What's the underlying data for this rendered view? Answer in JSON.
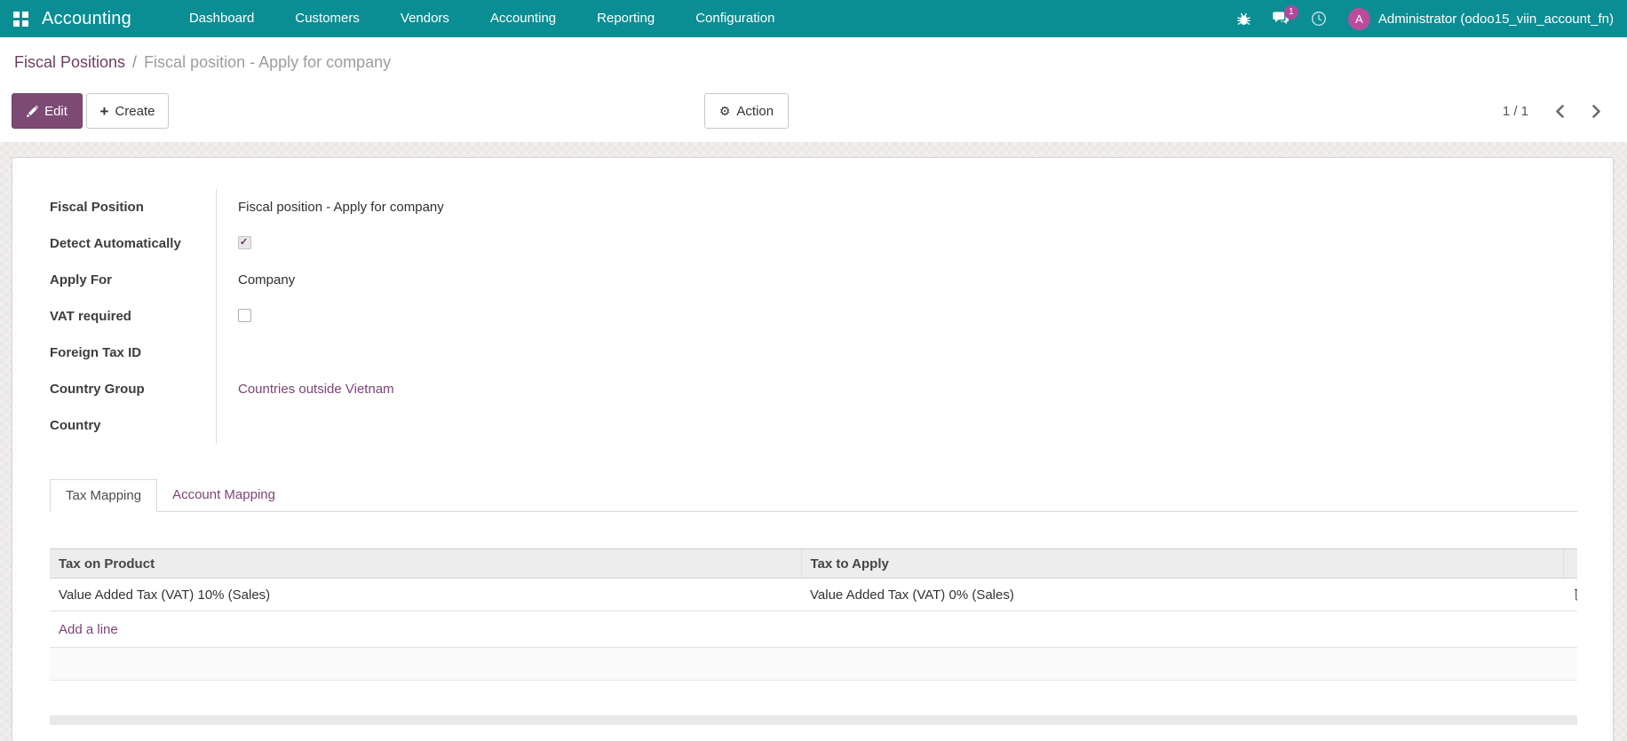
{
  "navbar": {
    "brand": "Accounting",
    "menu_items": [
      "Dashboard",
      "Customers",
      "Vendors",
      "Accounting",
      "Reporting",
      "Configuration"
    ],
    "badge_count": "1",
    "avatar_letter": "A",
    "user_name": "Administrator (odoo15_viin_account_fn)",
    "icons": [
      "apps-grid-icon",
      "bug-icon",
      "messages-icon",
      "activity-clock-icon"
    ]
  },
  "breadcrumb": {
    "parent": "Fiscal Positions",
    "separator": "/",
    "current": "Fiscal position - Apply for company"
  },
  "actions": {
    "edit": "Edit",
    "create": "Create",
    "action": "Action"
  },
  "pager": {
    "value": "1 / 1"
  },
  "form": {
    "fields": [
      {
        "label": "Fiscal Position",
        "type": "text",
        "value": "Fiscal position - Apply for company"
      },
      {
        "label": "Detect Automatically",
        "type": "checkbox",
        "checked": true
      },
      {
        "label": "Apply For",
        "type": "text",
        "value": "Company"
      },
      {
        "label": "VAT required",
        "type": "checkbox",
        "checked": false
      },
      {
        "label": "Foreign Tax ID",
        "type": "text",
        "value": ""
      },
      {
        "label": "Country Group",
        "type": "link",
        "value": "Countries outside Vietnam"
      },
      {
        "label": "Country",
        "type": "text",
        "value": ""
      }
    ]
  },
  "tabs": [
    {
      "label": "Tax Mapping",
      "active": true
    },
    {
      "label": "Account Mapping",
      "active": false
    }
  ],
  "tax_table": {
    "columns": [
      "Tax on Product",
      "Tax to Apply"
    ],
    "rows": [
      {
        "tax_on_product": "Value Added Tax (VAT) 10% (Sales)",
        "tax_to_apply": "Value Added Tax (VAT) 0% (Sales)"
      }
    ],
    "add_line_label": "Add a line"
  },
  "colors": {
    "navbar_bg": "#0b8e93",
    "primary_button": "#7d4a75",
    "link": "#7c4477",
    "breadcrumb_link": "#6d3f62",
    "badge": "#b5479b",
    "avatar_bg": "#bb4c9d",
    "table_header_bg": "#ededed"
  }
}
